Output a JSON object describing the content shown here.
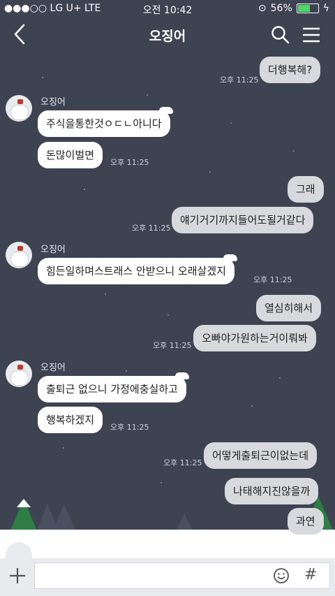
{
  "status_bar": {
    "carrier": "●●●○○ LG U+  LTE",
    "time": "오전 10:42",
    "battery": "56%",
    "battery_level": 0.56
  },
  "header": {
    "title": "오징어",
    "back_icon": "chevron-left-icon",
    "search_icon": "search-icon",
    "menu_icon": "hamburger-menu-icon"
  },
  "messages": [
    {
      "side": "out",
      "text": "더행복해?",
      "time": "오후 11:25"
    },
    {
      "side": "in",
      "sender": "오징어",
      "text": "주식을통한것ㅇㄷㄴ아니다"
    },
    {
      "side": "in",
      "text": "돈많이벌면",
      "time": "오후 11:25"
    },
    {
      "side": "out",
      "text": "그래"
    },
    {
      "side": "out",
      "text": "얘기거기까지들어도될거같다",
      "time": "오후 11:25"
    },
    {
      "side": "in",
      "sender": "오징어",
      "text": "힘든일하며스트래스 안받으니 오래살겠지",
      "time": "오후 11:25"
    },
    {
      "side": "out",
      "text": "열심히해서"
    },
    {
      "side": "out",
      "text": "오빠야가원하는거이뤄봐",
      "time": "오후 11:25"
    },
    {
      "side": "in",
      "sender": "오징어",
      "text": "출퇴근 없으니 가정에충실하고"
    },
    {
      "side": "in",
      "text": "행복하겠지",
      "time": "오후 11:25"
    },
    {
      "side": "out",
      "text": "어떻게출퇴근이없는데",
      "time": "오후 11:25"
    },
    {
      "side": "out",
      "text": "나태해지진않을까"
    },
    {
      "side": "out",
      "text": "과연"
    }
  ],
  "input_bar": {
    "placeholder": "",
    "plus_icon": "plus-icon",
    "emoji_icon": "emoji-smile-icon",
    "hash_label": "#"
  }
}
